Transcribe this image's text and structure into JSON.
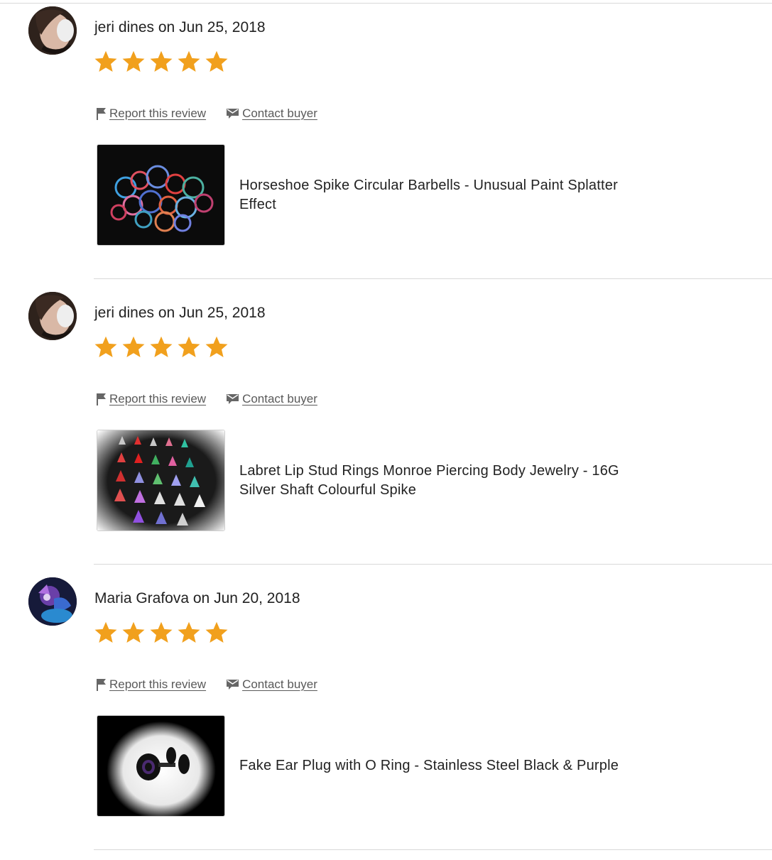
{
  "reviews": [
    {
      "reviewer": "jeri dines",
      "byline": "jeri dines on Jun 25, 2018",
      "rating": 5,
      "report_label": "Report this review",
      "contact_label": "Contact buyer",
      "item_title": "Horseshoe Spike Circular Barbells - Unusual Paint Splatter Effect"
    },
    {
      "reviewer": "jeri dines",
      "byline": "jeri dines on Jun 25, 2018",
      "rating": 5,
      "report_label": "Report this review",
      "contact_label": "Contact buyer",
      "item_title": "Labret Lip Stud Rings Monroe Piercing Body Jewelry - 16G Silver Shaft Colourful Spike"
    },
    {
      "reviewer": "Maria Grafova",
      "byline": "Maria Grafova on Jun 20, 2018",
      "rating": 5,
      "report_label": "Report this review",
      "contact_label": "Contact buyer",
      "item_title": "Fake Ear Plug with O Ring - Stainless Steel Black & Purple"
    }
  ],
  "icons": {
    "star": "star-icon",
    "report": "flag-icon",
    "contact": "message-icon"
  },
  "colors": {
    "star": "#f1a01d",
    "text": "#222222",
    "muted_link": "#595959",
    "divider": "#d9d9d9"
  }
}
